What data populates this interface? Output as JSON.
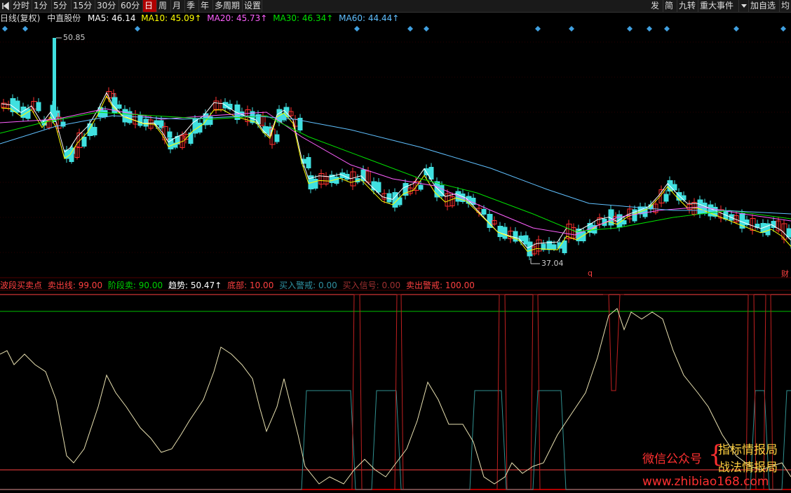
{
  "toolbar": {
    "back_icon": "back-arrow-icon",
    "periods": [
      "分时",
      "1分",
      "5分",
      "15分",
      "30分",
      "60分",
      "日",
      "周",
      "月",
      "季",
      "年",
      "多周期",
      "设置"
    ],
    "active_period": "日",
    "right_items": [
      "发",
      "简",
      "九转",
      "重大事件",
      "加自选",
      "均"
    ],
    "dropdown_icon": "triangle-down-icon"
  },
  "price_legend": {
    "title": "日线(复权)",
    "stock": "中直股份",
    "ma": [
      {
        "name": "MA5",
        "value": "46.14",
        "color": "#ffffff"
      },
      {
        "name": "MA10",
        "value": "45.09↑",
        "color": "#ffff00"
      },
      {
        "name": "MA20",
        "value": "45.73↑",
        "color": "#ff60ff"
      },
      {
        "name": "MA30",
        "value": "46.34↑",
        "color": "#00e000"
      },
      {
        "name": "MA60",
        "value": "44.44↑",
        "color": "#60c0ff"
      }
    ]
  },
  "price_panel": {
    "high_label": "50.85",
    "low_label": "37.04",
    "q_label": "q",
    "cai_label": "财"
  },
  "indicator_legend": {
    "name": "波段买卖点",
    "items": [
      {
        "label": "卖出线:",
        "value": "99.00",
        "color": "#ff4040"
      },
      {
        "label": "阶段卖:",
        "value": "90.00",
        "color": "#00d000"
      },
      {
        "label": "趋势:",
        "value": "50.47↑",
        "color": "#ffffff"
      },
      {
        "label": "底部:",
        "value": "10.00",
        "color": "#ff4040"
      },
      {
        "label": "买入警戒:",
        "value": "0.00",
        "color": "#3090a0"
      },
      {
        "label": "买入信号:",
        "value": "0.00",
        "color": "#a03030"
      },
      {
        "label": "卖出警戒:",
        "value": "100.00",
        "color": "#ff4040"
      }
    ]
  },
  "watermark": {
    "wechat": "微信公众号",
    "line1": "指标情报局",
    "line2": "战法情报局",
    "url": "www.zhibiao168.com"
  },
  "colors": {
    "candle_up": "#ff3030",
    "candle_down": "#40e0e0",
    "ma5": "#ffffff",
    "ma10": "#ffff00",
    "ma20": "#ff60ff",
    "ma30": "#00e000",
    "ma60": "#60c0ff",
    "trend": "#e8e0b0",
    "signal_red": "#c02020",
    "buy_warn": "#309090",
    "sell_line": "#ff4040",
    "stage_sell": "#00c000"
  }
}
